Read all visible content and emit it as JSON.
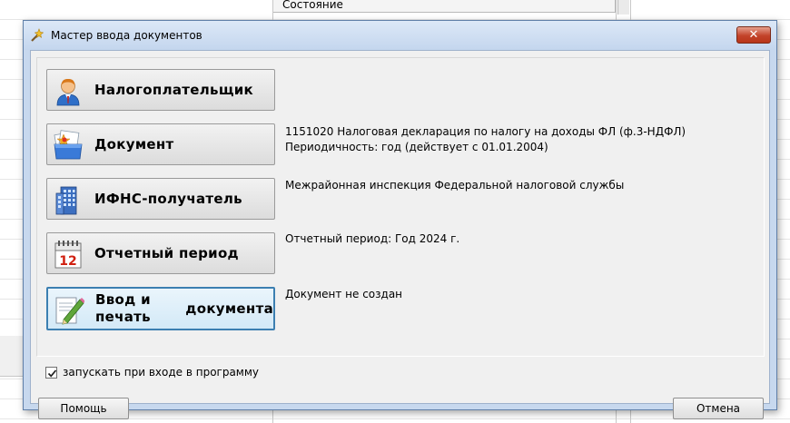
{
  "background": {
    "column_header": "Состояние"
  },
  "dialog": {
    "title": "Мастер ввода документов",
    "close_label": "✕",
    "steps": [
      {
        "label": "Налогоплательщик",
        "icon": "taxpayer-person-icon",
        "info": []
      },
      {
        "label": "Документ",
        "icon": "document-folder-icon",
        "info": [
          "1151020 Налоговая декларация по налогу на доходы ФЛ (ф.3-НДФЛ)",
          "Периодичность: год (действует с 01.01.2004)"
        ]
      },
      {
        "label": "ИФНС-получатель",
        "icon": "building-icon",
        "info": [
          "Межрайонная инспекция Федеральной налоговой службы"
        ]
      },
      {
        "label": "Отчетный период",
        "icon": "calendar-icon",
        "info": [
          "Отчетный период: Год 2024 г."
        ]
      },
      {
        "label_line1": "Ввод и печать",
        "label_line2": "документа",
        "icon": "pencil-document-icon",
        "info": [
          "Документ не создан"
        ]
      }
    ],
    "autostart_checkbox": {
      "label": "запускать при входе в программу",
      "checked": true
    },
    "help_button": "Помощь",
    "cancel_button": "Отмена"
  }
}
